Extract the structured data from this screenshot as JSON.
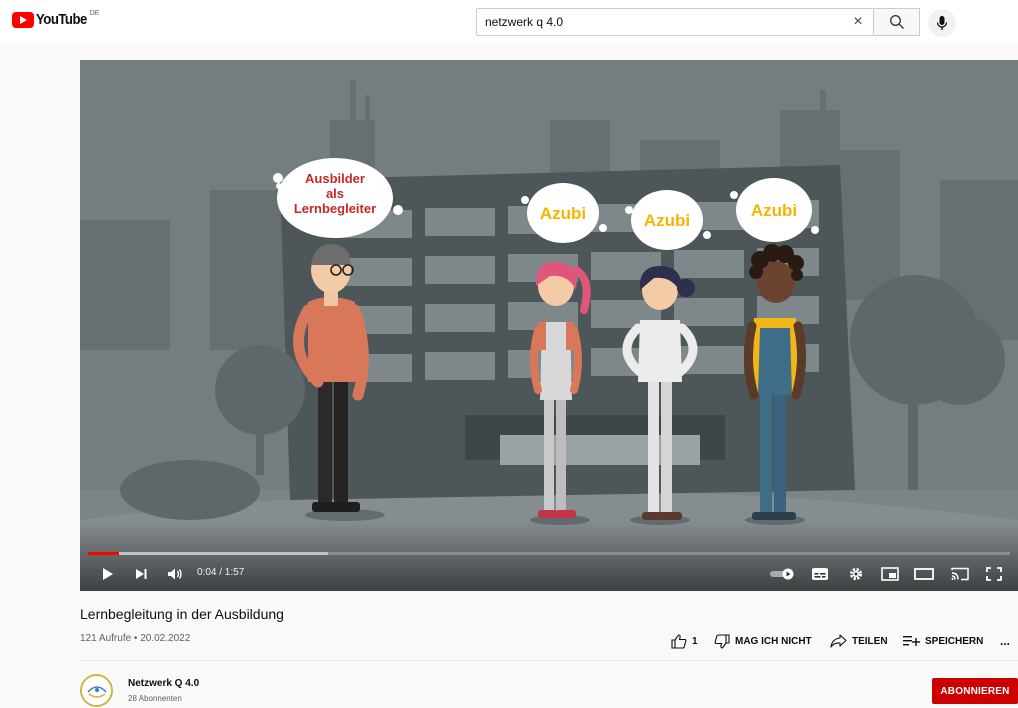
{
  "header": {
    "logo_text": "YouTube",
    "country": "DE",
    "search_value": "netzwerk q 4.0"
  },
  "player": {
    "current_time": "0:04",
    "duration": "1:57",
    "time_text": "0:04 / 1:57",
    "progress_fraction": 0.034,
    "scene": {
      "bubbles": [
        "Ausbilder als Lernbegleiter",
        "Azubi",
        "Azubi",
        "Azubi"
      ],
      "bubble_lines": [
        "Ausbilder",
        "als",
        "Lernbegleiter"
      ]
    }
  },
  "video": {
    "title": "Lernbegleitung in der Ausbildung",
    "meta": "121 Aufrufe • 20.02.2022"
  },
  "actions": {
    "like_count": "1",
    "dislike_label": "MAG ICH NICHT",
    "share_label": "TEILEN",
    "save_label": "SPEICHERN",
    "more_label": "..."
  },
  "channel": {
    "name": "Netzwerk Q 4.0",
    "subscribers": "28 Abonnenten",
    "subscribe_label": "ABONNIEREN"
  },
  "colors": {
    "brand_red": "#ff0000",
    "subscribe_red": "#cc0000",
    "bubble_red": "#c62828",
    "bubble_yellow": "#f5b400"
  }
}
